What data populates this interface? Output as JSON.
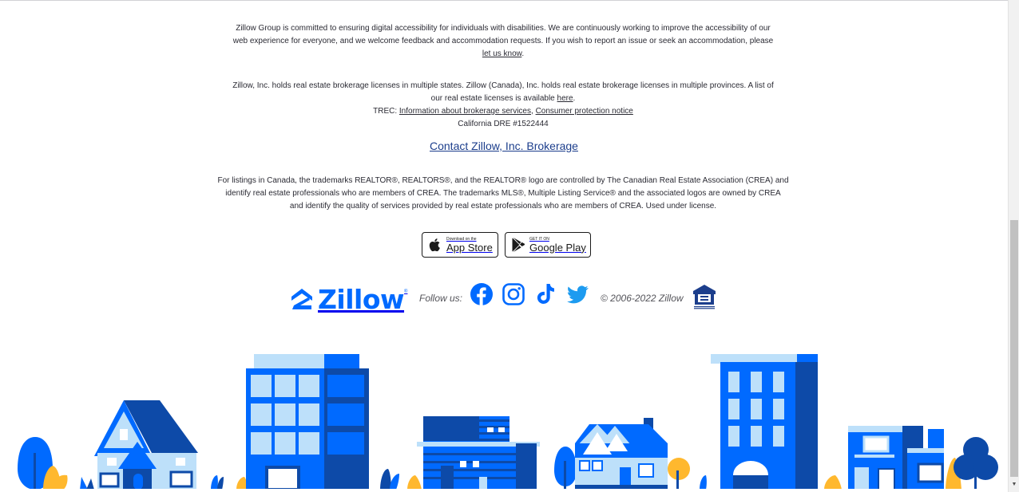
{
  "accessibility": {
    "line1": "Zillow Group is committed to ensuring digital accessibility for individuals with disabilities. We are continuously working to improve the accessibility of our",
    "line2": "web experience for everyone, and we welcome feedback and accommodation requests. If you wish to report an issue or seek an accommodation, please",
    "link": "let us know",
    "suffix": "."
  },
  "licensing": {
    "line1": "Zillow, Inc. holds real estate brokerage licenses in multiple states. Zillow (Canada), Inc. holds real estate brokerage licenses in multiple provinces. A list of",
    "line2_prefix": "our real estate licenses is available ",
    "here_link": "here",
    "line2_suffix": ".",
    "trec_prefix": "TREC: ",
    "trec_link1": "Information about brokerage services",
    "trec_separator": ", ",
    "trec_link2": "Consumer protection notice",
    "california": "California DRE #1522444"
  },
  "contact_link": "Contact Zillow, Inc. Brokerage",
  "canada": {
    "line1": "For listings in Canada, the trademarks REALTOR®, REALTORS®, and the REALTOR® logo are controlled by The Canadian Real Estate Association (CREA) and",
    "line2": "identify real estate professionals who are members of CREA. The trademarks MLS®, Multiple Listing Service® and the associated logos are owned by CREA",
    "line3": "and identify the quality of services provided by real estate professionals who are members of CREA. Used under license."
  },
  "app_store": {
    "small": "Download on the",
    "big": "App Store"
  },
  "google_play": {
    "small": "GET IT ON",
    "big": "Google Play"
  },
  "brand": {
    "logo_text": "Zillow",
    "logo_reg": "®",
    "follow_label": "Follow us:",
    "copyright": "© 2006-2022 Zillow"
  },
  "icons": {
    "apple": "apple-icon",
    "google_play": "google-play-icon",
    "facebook": "facebook-icon",
    "instagram": "instagram-icon",
    "tiktok": "tiktok-icon",
    "twitter": "twitter-icon",
    "equal_housing": "equal-housing-icon"
  },
  "colors": {
    "brand_blue": "#006aff",
    "dark_blue": "#0d4aa8",
    "light_blue": "#bde0fa",
    "link_blue": "#1c3e8c",
    "tree_yellow": "#ffb82e",
    "twitter_blue": "#1d9bf0"
  }
}
